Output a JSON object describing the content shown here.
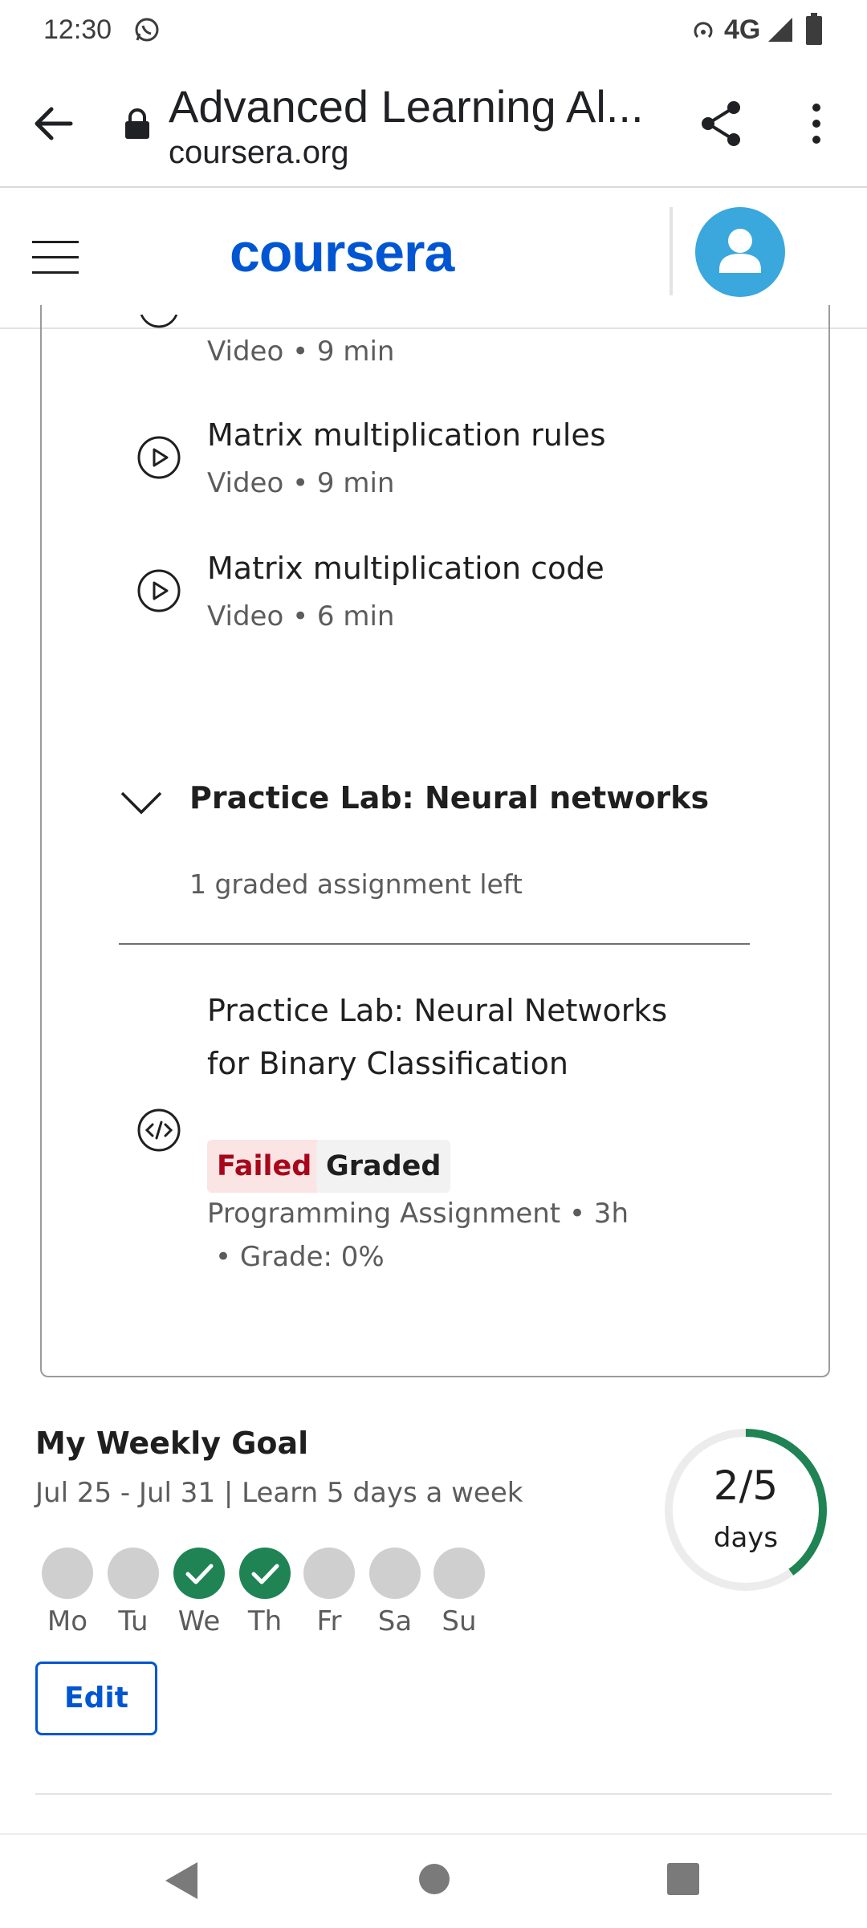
{
  "status_bar": {
    "time": "12:30",
    "network": "4G"
  },
  "browser": {
    "title": "Advanced Learning Al...",
    "url": "coursera.org"
  },
  "header": {
    "logo_text": "coursera"
  },
  "course_items": [
    {
      "title": "",
      "meta": "Video • 9 min",
      "icon": "play-icon"
    },
    {
      "title": "Matrix multiplication rules",
      "meta": "Video • 9 min",
      "icon": "play-icon"
    },
    {
      "title": "Matrix multiplication code",
      "meta": "Video • 6 min",
      "icon": "play-icon"
    }
  ],
  "section": {
    "title": "Practice Lab: Neural networks",
    "subtitle": "1 graded assignment left"
  },
  "lab": {
    "title": "Practice Lab: Neural Networks for Binary Classification",
    "badge_failed": "Failed",
    "badge_graded": "Graded",
    "meta": "Programming Assignment • 3h",
    "grade": "• Grade: 0%"
  },
  "weekly_goal": {
    "title": "My Weekly Goal",
    "subtitle": "Jul 25 - Jul 31 | Learn 5 days a week",
    "days": [
      {
        "label": "Mo",
        "done": false
      },
      {
        "label": "Tu",
        "done": false
      },
      {
        "label": "We",
        "done": true
      },
      {
        "label": "Th",
        "done": true
      },
      {
        "label": "Fr",
        "done": false
      },
      {
        "label": "Sa",
        "done": false
      },
      {
        "label": "Su",
        "done": false
      }
    ],
    "progress_value": "2/5",
    "progress_unit": "days",
    "progress_fraction": 0.4,
    "edit_label": "Edit"
  },
  "colors": {
    "brand": "#0056d2",
    "success": "#1f8354",
    "failed": "#a8061a",
    "avatar": "#3aa7dd"
  }
}
